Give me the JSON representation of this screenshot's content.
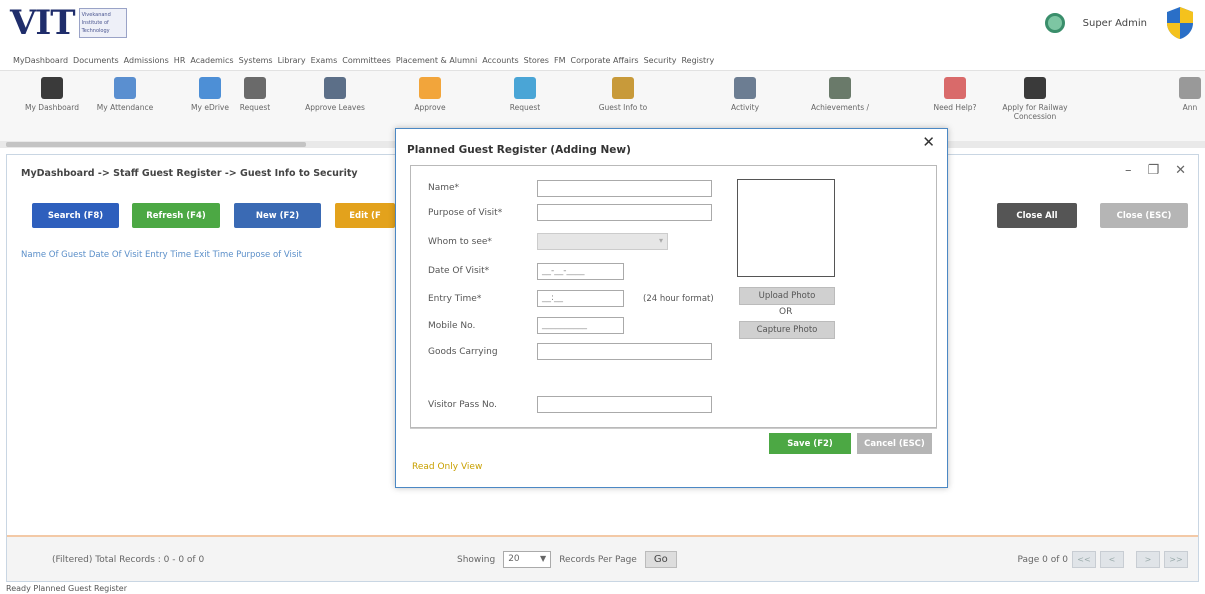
{
  "header": {
    "logo_text": "VIT",
    "logo_sub": "Vivekanand Institute of Technology",
    "user_name": "Super Admin"
  },
  "menubar": [
    "MyDashboard",
    "Documents",
    "Admissions",
    "HR",
    "Academics",
    "Systems",
    "Library",
    "Exams",
    "Committees",
    "Placement & Alumni",
    "Accounts",
    "Stores",
    "FM",
    "Corporate Affairs",
    "Security",
    "Registry"
  ],
  "toolbar": [
    {
      "label": "My Dashboard",
      "icon": "home-icon",
      "color": "#3a3a3a"
    },
    {
      "label": "My Attendance",
      "icon": "calendar-icon",
      "color": "#5a8fd0"
    },
    {
      "label": "My eDrive",
      "icon": "cloud-icon",
      "color": "#4d8fd6"
    },
    {
      "label": "Request",
      "icon": "phone-icon",
      "color": "#6a6a6a"
    },
    {
      "label": "Approve Leaves",
      "icon": "checkbox-icon",
      "color": "#5c6f88"
    },
    {
      "label": "Approve",
      "icon": "approve-icon",
      "color": "#f2a53b"
    },
    {
      "label": "Request",
      "icon": "request-icon",
      "color": "#4aa5d6"
    },
    {
      "label": "Guest Info to",
      "icon": "guest-icon",
      "color": "#c89a3a"
    },
    {
      "label": "Activity",
      "icon": "activity-icon",
      "color": "#6c7d92"
    },
    {
      "label": "Achievements /",
      "icon": "medal-icon",
      "color": "#6a7a6a"
    },
    {
      "label": "Need Help?",
      "icon": "help-icon",
      "color": "#d96a6a"
    },
    {
      "label": "Apply for Railway Concession",
      "icon": "train-icon",
      "color": "#3a3a3a"
    },
    {
      "label": "Ann",
      "icon": "announce-icon",
      "color": "#999999"
    }
  ],
  "main": {
    "breadcrumb": "MyDashboard -> Staff Guest Register -> Guest Info to Security",
    "buttons": {
      "search": "Search (F8)",
      "refresh": "Refresh (F4)",
      "new": "New (F2)",
      "edit": "Edit (F",
      "close_all": "Close All",
      "close": "Close (ESC)"
    },
    "grid_header": "Name Of Guest  Date Of Visit  Entry Time  Exit Time  Purpose of Visit"
  },
  "footer": {
    "records": "(Filtered) Total Records : 0 - 0 of 0",
    "showing_label": "Showing",
    "page_size": "20",
    "records_per_page": "Records Per Page",
    "go": "Go",
    "page_info": "Page 0 of 0",
    "first": "<<",
    "prev": "<",
    "next": ">",
    "last": ">>"
  },
  "status_bar": "Ready  Planned Guest Register",
  "modal": {
    "title": "Planned Guest Register (Adding New)",
    "close": "✕",
    "fields": {
      "name_label": "Name*",
      "purpose_label": "Purpose of Visit*",
      "whom_label": "Whom to see*",
      "date_label": "Date Of Visit*",
      "date_placeholder": "__-__-____",
      "entry_label": "Entry Time*",
      "entry_placeholder": "__:__",
      "entry_hint": "(24 hour format)",
      "mobile_label": "Mobile No.",
      "mobile_placeholder": "__________",
      "goods_label": "Goods Carrying",
      "pass_label": "Visitor Pass No."
    },
    "upload_photo": "Upload Photo",
    "or": "OR",
    "capture_photo": "Capture Photo",
    "save": "Save (F2)",
    "cancel": "Cancel (ESC)",
    "readonly": "Read Only View"
  }
}
